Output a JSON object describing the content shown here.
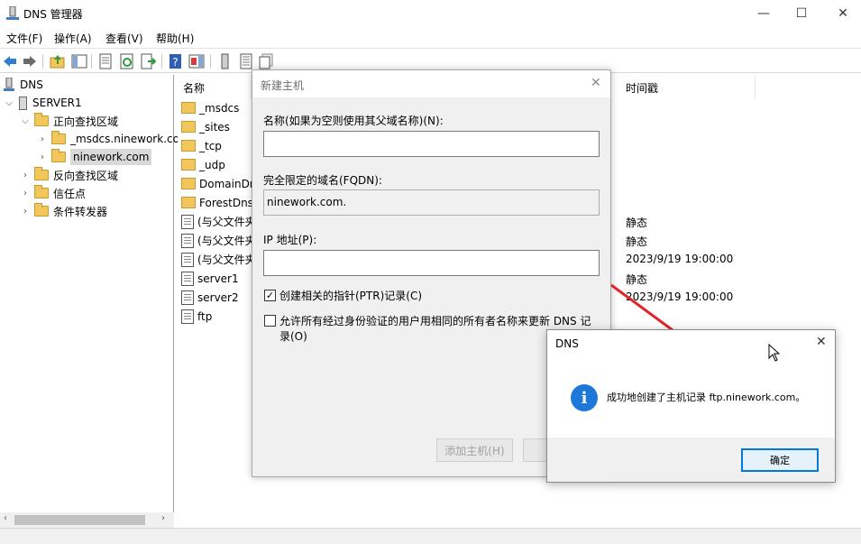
{
  "window": {
    "title": "DNS 管理器",
    "minimize": "—",
    "maximize": "☐",
    "close": "✕"
  },
  "menu": [
    "文件(F)",
    "操作(A)",
    "查看(V)",
    "帮助(H)"
  ],
  "tree": {
    "root": "DNS",
    "server": "SERVER1",
    "forward_zone": "正向查找区域",
    "zone_msdcs": "_msdcs.ninework.co",
    "zone_ninework": "ninework.com",
    "reverse_zone": "反向查找区域",
    "trust_points": "信任点",
    "conditional_forwarders": "条件转发器"
  },
  "list": {
    "col_name": "名称",
    "col_timestamp": "时间戳",
    "rows": [
      {
        "name": "_msdcs",
        "icon": "folder-doc",
        "timestamp": ""
      },
      {
        "name": "_sites",
        "icon": "folder",
        "timestamp": ""
      },
      {
        "name": "_tcp",
        "icon": "folder",
        "timestamp": ""
      },
      {
        "name": "_udp",
        "icon": "folder",
        "timestamp": ""
      },
      {
        "name": "DomainDn",
        "icon": "folder",
        "timestamp": ""
      },
      {
        "name": "ForestDns",
        "icon": "folder",
        "timestamp": ""
      },
      {
        "name": "(与父文件夹",
        "icon": "record",
        "timestamp": "静态"
      },
      {
        "name": "(与父文件夹",
        "icon": "record",
        "timestamp": "静态"
      },
      {
        "name": "(与父文件夹",
        "icon": "record",
        "timestamp": "2023/9/19 19:00:00"
      },
      {
        "name": "server1",
        "icon": "record",
        "timestamp": "静态"
      },
      {
        "name": "server2",
        "icon": "record",
        "timestamp": "2023/9/19 19:00:00"
      },
      {
        "name": "ftp",
        "icon": "record",
        "timestamp": ""
      }
    ]
  },
  "new_host_dialog": {
    "title": "新建主机",
    "name_label": "名称(如果为空则使用其父域名称)(N):",
    "name_value": "",
    "fqdn_label": "完全限定的域名(FQDN):",
    "fqdn_value": "ninework.com.",
    "ip_label": "IP 地址(P):",
    "ip_value": "",
    "ptr_label": "创建相关的指针(PTR)记录(C)",
    "ptr_checked": true,
    "allow_update_label_1": "允许所有经过身份验证的用户用相同的所有者名称来更新 DNS 记",
    "allow_update_label_2": "录(O)",
    "allow_update_checked": false,
    "add_host_button": "添加主机(H)"
  },
  "message_box": {
    "title": "DNS",
    "message": "成功地创建了主机记录 ftp.ninework.com。",
    "ok_button": "确定"
  },
  "colors": {
    "annotation_arrow": "#e0262a",
    "info_icon": "#1e78d7",
    "ok_button_border": "#0078d7"
  }
}
